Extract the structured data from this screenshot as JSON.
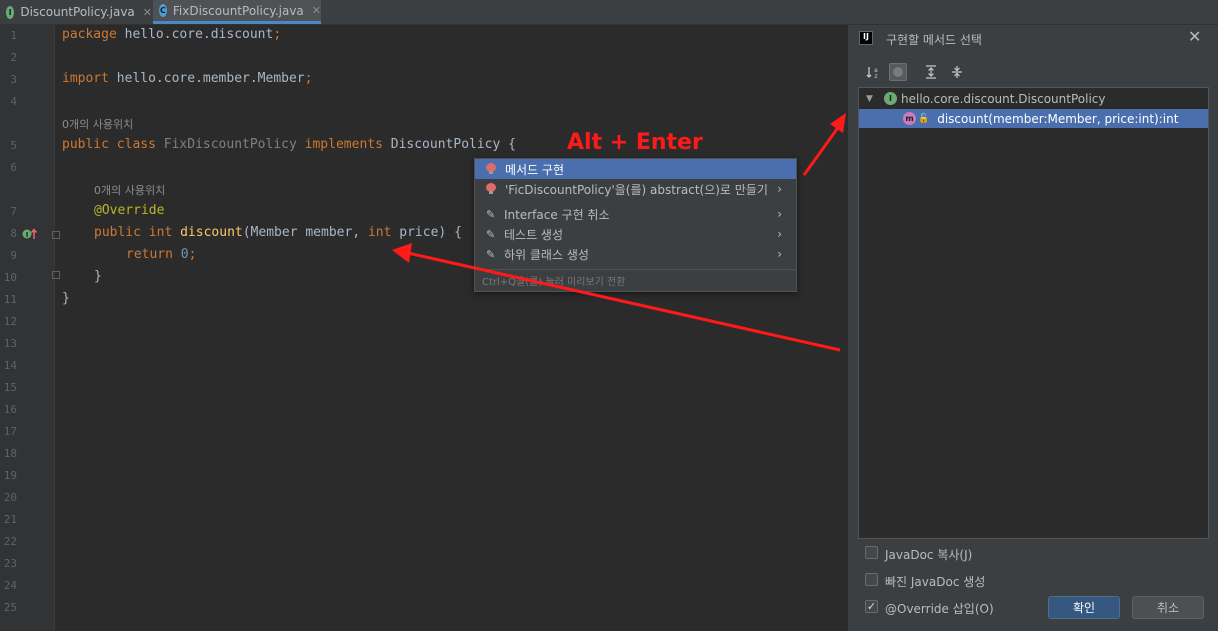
{
  "tabs": [
    {
      "label": "DiscountPolicy.java",
      "icon": "I",
      "icon_color": "#6aab73"
    },
    {
      "label": "FixDiscountPolicy.java",
      "icon": "C",
      "icon_color": "#4a9ed6"
    }
  ],
  "close_glyph": "✕",
  "line_numbers": [
    "1",
    "2",
    "3",
    "4",
    "5",
    "6",
    "7",
    "8",
    "9",
    "10",
    "11",
    "12",
    "13",
    "14",
    "15",
    "16",
    "17",
    "18",
    "19",
    "20",
    "21",
    "22",
    "23",
    "24",
    "25"
  ],
  "code": {
    "package_kw": "package",
    "package_name": " hello.core.discount",
    "semicolon": ";",
    "import_kw": "import",
    "import_name": " hello.core.member.Member",
    "usage_hint": "0개의 사용위치",
    "public_kw": "public",
    "class_kw": " class ",
    "class_name": "FixDiscountPolicy",
    "implements_kw": " implements ",
    "iface_name": "DiscountPolicy {",
    "override_ann": "@Override",
    "int_kw": " int ",
    "method_name": "discount",
    "params_open": "(Member member, ",
    "int_kw2": "int",
    "params_close": " price) {",
    "return_kw": "return ",
    "return_val": "0",
    "close_method": "}",
    "close_class": "}"
  },
  "annotation_label": "Alt + Enter",
  "popup": {
    "items": [
      {
        "label": "메서드 구현",
        "kind": "bulb",
        "submenu": false
      },
      {
        "label": "'FicDiscountPolicy'을(를) abstract(으)로 만들기",
        "kind": "bulb",
        "submenu": true
      },
      {
        "label": "Interface 구현 취소",
        "kind": "pencil",
        "submenu": true
      },
      {
        "label": "테스트 생성",
        "kind": "pencil",
        "submenu": true
      },
      {
        "label": "하위 클래스 생성",
        "kind": "pencil",
        "submenu": true
      }
    ],
    "footer": "Ctrl+Q을(를) 눌러 미리보기 전환"
  },
  "dialog": {
    "title": "구현할 메서드 선택",
    "app_icon": "IJ",
    "tree_root": "hello.core.discount.DiscountPolicy",
    "tree_method": "discount(member:Member, price:int):int",
    "checkboxes": [
      {
        "label": "JavaDoc 복사(J)",
        "checked": false
      },
      {
        "label": "빠진 JavaDoc 생성",
        "checked": false
      },
      {
        "label": "@Override 삽입(O)",
        "checked": true
      }
    ],
    "ok_label": "확인",
    "cancel_label": "취소"
  },
  "colors": {
    "accent": "#4b6eaf",
    "arrow": "#ff1a1a"
  }
}
